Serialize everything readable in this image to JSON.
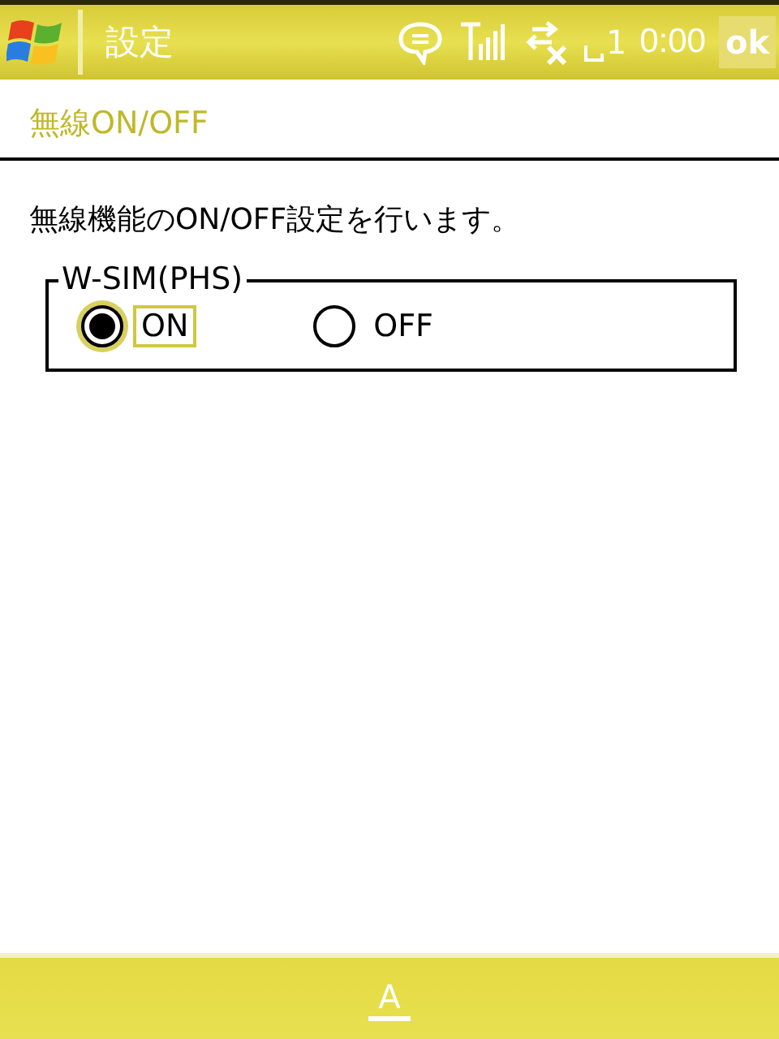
{
  "top_bar": {
    "title": "設定",
    "indicator": "1",
    "time": "0:00",
    "ok_button": "ok"
  },
  "page_title": "無線ON/OFF",
  "description": "無線機能のON/OFF設定を行います。",
  "group": {
    "label": "W-SIM(PHS)",
    "options": [
      {
        "label": "ON",
        "selected": true
      },
      {
        "label": "OFF",
        "selected": false
      }
    ]
  },
  "bottom_bar": {
    "input_key": "A"
  }
}
